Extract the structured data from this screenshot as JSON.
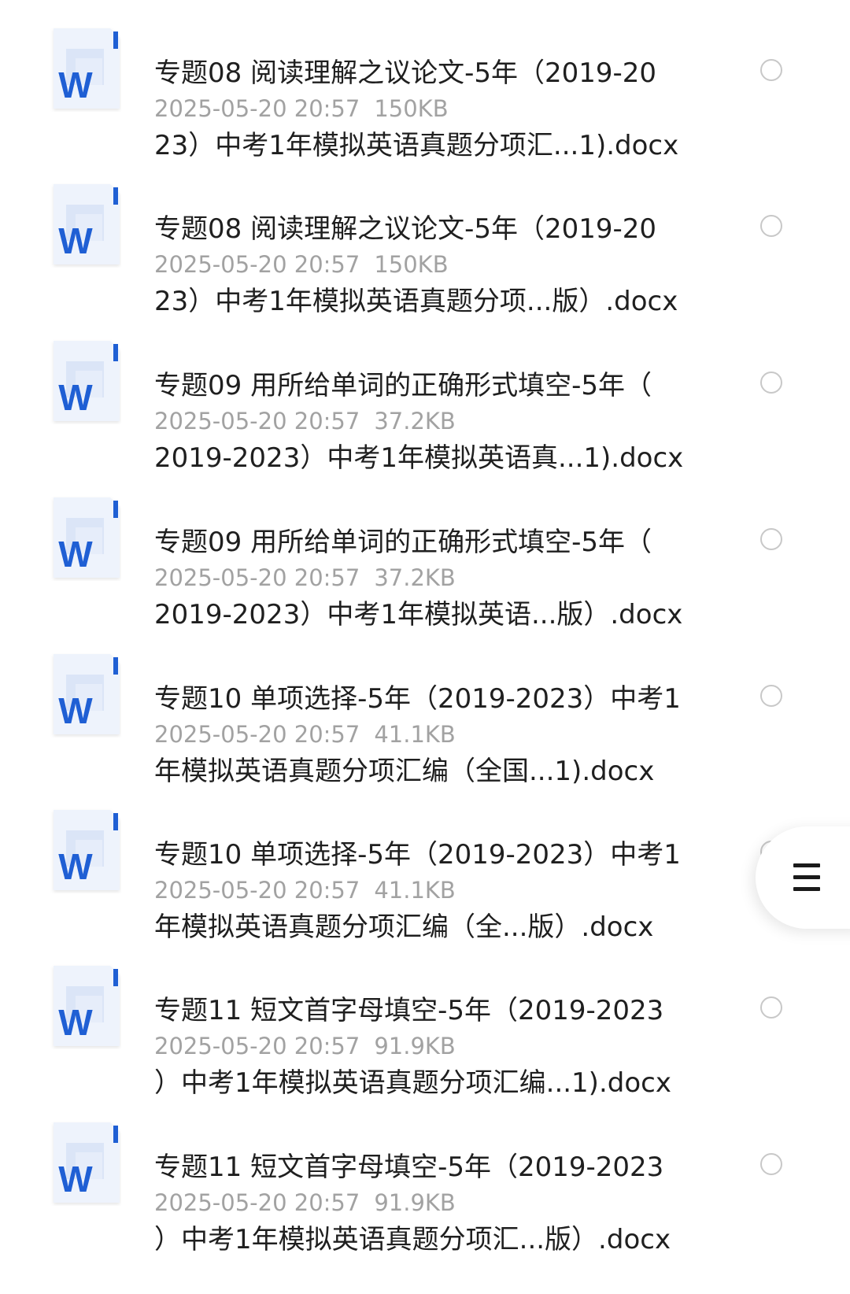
{
  "files": [
    {
      "name_line1": "专题08 阅读理解之议论文-5年（2019-20",
      "name_line2": "23）中考1年模拟英语真题分项汇...1).docx",
      "date": "2025-05-20 20:57",
      "size": "150KB",
      "icon": "word-doc-icon"
    },
    {
      "name_line1": "专题08 阅读理解之议论文-5年（2019-20",
      "name_line2": "23）中考1年模拟英语真题分项...版）.docx",
      "date": "2025-05-20 20:57",
      "size": "150KB",
      "icon": "word-doc-icon"
    },
    {
      "name_line1": "专题09 用所给单词的正确形式填空-5年（",
      "name_line2": "2019-2023）中考1年模拟英语真...1).docx",
      "date": "2025-05-20 20:57",
      "size": "37.2KB",
      "icon": "word-doc-icon"
    },
    {
      "name_line1": "专题09 用所给单词的正确形式填空-5年（",
      "name_line2": "2019-2023）中考1年模拟英语...版）.docx",
      "date": "2025-05-20 20:57",
      "size": "37.2KB",
      "icon": "word-doc-icon"
    },
    {
      "name_line1": "专题10 单项选择-5年（2019-2023）中考1",
      "name_line2": "年模拟英语真题分项汇编（全国...1).docx",
      "date": "2025-05-20 20:57",
      "size": "41.1KB",
      "icon": "word-doc-icon"
    },
    {
      "name_line1": "专题10 单项选择-5年（2019-2023）中考1",
      "name_line2": "年模拟英语真题分项汇编（全...版）.docx",
      "date": "2025-05-20 20:57",
      "size": "41.1KB",
      "icon": "word-doc-icon"
    },
    {
      "name_line1": "专题11 短文首字母填空-5年（2019-2023",
      "name_line2": "）中考1年模拟英语真题分项汇编...1).docx",
      "date": "2025-05-20 20:57",
      "size": "91.9KB",
      "icon": "word-doc-icon"
    },
    {
      "name_line1": "专题11 短文首字母填空-5年（2019-2023",
      "name_line2": "）中考1年模拟英语真题分项汇...版）.docx",
      "date": "2025-05-20 20:57",
      "size": "91.9KB",
      "icon": "word-doc-icon"
    }
  ],
  "floating_menu": {
    "icon": "menu-icon"
  },
  "colors": {
    "word_blue": "#1f5fd4",
    "icon_paper": "#eef3fc",
    "meta_gray": "#a2a2a2",
    "title_text": "#1f1f1f",
    "radio_border": "#c8c8c8"
  }
}
